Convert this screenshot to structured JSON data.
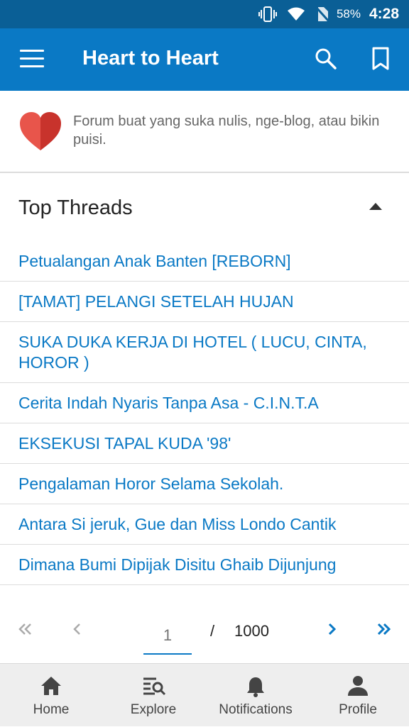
{
  "status_bar": {
    "battery": "58%",
    "time": "4:28"
  },
  "app_bar": {
    "title": "Heart to Heart"
  },
  "forum": {
    "description": "Forum buat yang suka nulis, nge-blog, atau bikin puisi."
  },
  "section": {
    "title": "Top Threads"
  },
  "threads": [
    "Petualangan Anak Banten [REBORN]",
    "[TAMAT] PELANGI SETELAH HUJAN",
    "SUKA DUKA KERJA DI HOTEL ( LUCU, CINTA, HOROR )",
    "Cerita Indah Nyaris Tanpa Asa - C.I.N.T.A",
    "EKSEKUSI TAPAL KUDA '98'",
    "Pengalaman Horor Selama Sekolah.",
    "Antara Si jeruk, Gue dan Miss Londo Cantik",
    "Dimana Bumi Dipijak Disitu Ghaib Dijunjung"
  ],
  "pagination": {
    "current_page": "1",
    "separator": "/",
    "total_pages": "1000"
  },
  "bottom_nav": {
    "home": "Home",
    "explore": "Explore",
    "notifications": "Notifications",
    "profile": "Profile"
  },
  "colors": {
    "primary": "#0a79c5",
    "status_bar": "#0a5f96",
    "heart": "#d63b35"
  },
  "icons": [
    "vibrate-icon",
    "wifi-icon",
    "no-sim-icon",
    "menu-icon",
    "search-icon",
    "bookmark-icon",
    "heart-icon",
    "caret-up-icon",
    "first-page-icon",
    "prev-page-icon",
    "next-page-icon",
    "last-page-icon",
    "home-icon",
    "explore-icon",
    "bell-icon",
    "person-icon"
  ]
}
